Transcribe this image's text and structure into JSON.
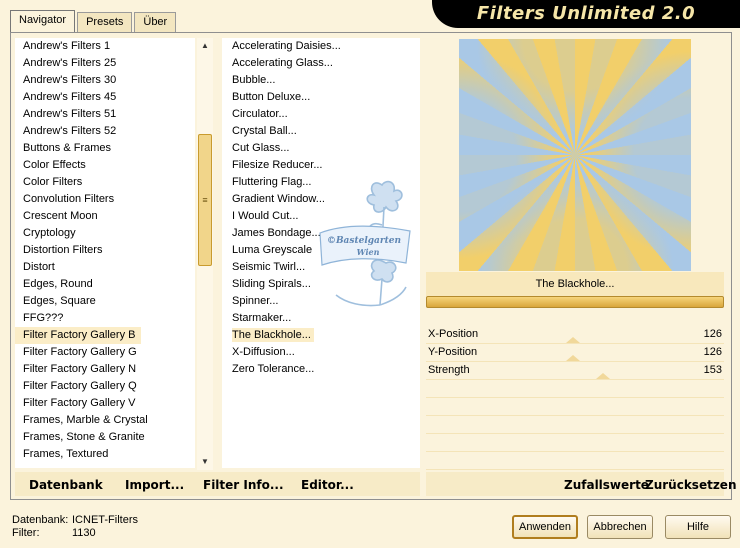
{
  "app": {
    "title": "Filters Unlimited 2.0"
  },
  "tabs": [
    "Navigator",
    "Presets",
    "Über"
  ],
  "categories": [
    "Andrew's Filters 1",
    "Andrew's Filters 25",
    "Andrew's Filters 30",
    "Andrew's Filters 45",
    "Andrew's Filters 51",
    "Andrew's Filters 52",
    "Buttons & Frames",
    "Color Effects",
    "Color Filters",
    "Convolution Filters",
    "Crescent Moon",
    "Cryptology",
    "Distortion Filters",
    "Distort",
    "Edges, Round",
    "Edges, Square",
    "FFG???",
    "Filter Factory Gallery B",
    "Filter Factory Gallery G",
    "Filter Factory Gallery N",
    "Filter Factory Gallery Q",
    "Filter Factory Gallery V",
    "Frames, Marble & Crystal",
    "Frames, Stone & Granite",
    "Frames, Textured"
  ],
  "selected_category": "Filter Factory Gallery B",
  "filters": [
    "Accelerating Daisies...",
    "Accelerating Glass...",
    "Bubble...",
    "Button Deluxe...",
    "Circulator...",
    "Crystal Ball...",
    "Cut Glass...",
    "Filesize Reducer...",
    "Fluttering Flag...",
    "Gradient Window...",
    "I Would Cut...",
    "James Bondage...",
    "Luma Greyscale",
    "Seismic Twirl...",
    "Sliding Spirals...",
    "Spinner...",
    "Starmaker...",
    "The Blackhole...",
    "X-Diffusion...",
    "Zero Tolerance..."
  ],
  "selected_filter": "The Blackhole...",
  "watermark": {
    "line1": "©Bastelgarten",
    "line2": "Wien"
  },
  "preview": {
    "filter_name": "The Blackhole..."
  },
  "params": [
    {
      "label": "X-Position",
      "value": 126,
      "max": 255
    },
    {
      "label": "Y-Position",
      "value": 126,
      "max": 255
    },
    {
      "label": "Strength",
      "value": 153,
      "max": 255
    }
  ],
  "left_buttons": [
    "Datenbank",
    "Import...",
    "Filter Info...",
    "Editor..."
  ],
  "right_buttons": [
    "Zufallswerte",
    "Zurücksetzen"
  ],
  "status": {
    "db_label": "Datenbank:",
    "db_value": "ICNET-Filters",
    "filter_label": "Filter:",
    "filter_value": "1130"
  },
  "dialog_buttons": {
    "apply": "Anwenden",
    "cancel": "Abbrechen",
    "help": "Hilfe"
  },
  "colors": {
    "accent": "#f1d58a",
    "selection": "#fbedc7",
    "background": "#fbf3dc"
  }
}
